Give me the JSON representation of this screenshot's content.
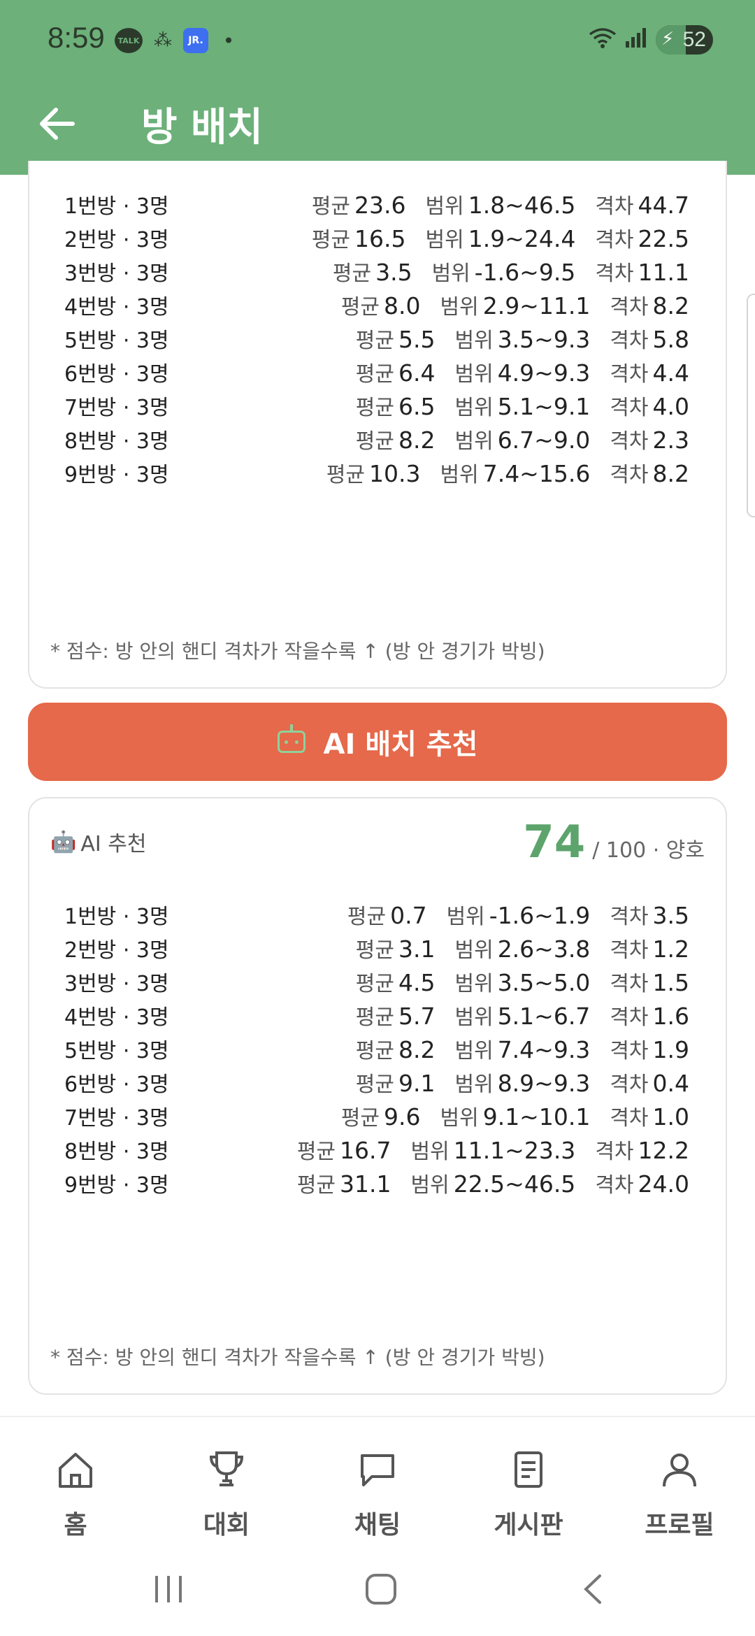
{
  "status": {
    "time": "8:59",
    "notif_talk": "TALK",
    "notif_jr": "JR.",
    "battery": "52"
  },
  "appbar": {
    "title": "방 배치"
  },
  "labels": {
    "avg": "평균",
    "range": "범위",
    "gap": "격차"
  },
  "current": {
    "rows": [
      {
        "name": "1번방 · 3명",
        "avg": "23.6",
        "range": "1.8~46.5",
        "gap": "44.7"
      },
      {
        "name": "2번방 · 3명",
        "avg": "16.5",
        "range": "1.9~24.4",
        "gap": "22.5"
      },
      {
        "name": "3번방 · 3명",
        "avg": "3.5",
        "range": "-1.6~9.5",
        "gap": "11.1"
      },
      {
        "name": "4번방 · 3명",
        "avg": "8.0",
        "range": "2.9~11.1",
        "gap": "8.2"
      },
      {
        "name": "5번방 · 3명",
        "avg": "5.5",
        "range": "3.5~9.3",
        "gap": "5.8"
      },
      {
        "name": "6번방 · 3명",
        "avg": "6.4",
        "range": "4.9~9.3",
        "gap": "4.4"
      },
      {
        "name": "7번방 · 3명",
        "avg": "6.5",
        "range": "5.1~9.1",
        "gap": "4.0"
      },
      {
        "name": "8번방 · 3명",
        "avg": "8.2",
        "range": "6.7~9.0",
        "gap": "2.3"
      },
      {
        "name": "9번방 · 3명",
        "avg": "10.3",
        "range": "7.4~15.6",
        "gap": "8.2"
      }
    ],
    "note": "* 점수: 방 안의 핸디 격차가 작을수록 ↑ (방 안 경기가 박빙)"
  },
  "ai_button": {
    "label": "AI 배치 추천"
  },
  "ai": {
    "header_label": "AI 추천",
    "score": "74",
    "score_suffix": "/ 100 · 양호",
    "rows": [
      {
        "name": "1번방 · 3명",
        "avg": "0.7",
        "range": "-1.6~1.9",
        "gap": "3.5"
      },
      {
        "name": "2번방 · 3명",
        "avg": "3.1",
        "range": "2.6~3.8",
        "gap": "1.2"
      },
      {
        "name": "3번방 · 3명",
        "avg": "4.5",
        "range": "3.5~5.0",
        "gap": "1.5"
      },
      {
        "name": "4번방 · 3명",
        "avg": "5.7",
        "range": "5.1~6.7",
        "gap": "1.6"
      },
      {
        "name": "5번방 · 3명",
        "avg": "8.2",
        "range": "7.4~9.3",
        "gap": "1.9"
      },
      {
        "name": "6번방 · 3명",
        "avg": "9.1",
        "range": "8.9~9.3",
        "gap": "0.4"
      },
      {
        "name": "7번방 · 3명",
        "avg": "9.6",
        "range": "9.1~10.1",
        "gap": "1.0"
      },
      {
        "name": "8번방 · 3명",
        "avg": "16.7",
        "range": "11.1~23.3",
        "gap": "12.2"
      },
      {
        "name": "9번방 · 3명",
        "avg": "31.1",
        "range": "22.5~46.5",
        "gap": "24.0"
      }
    ],
    "note": "* 점수: 방 안의 핸디 격차가 작을수록 ↑ (방 안 경기가 박빙)"
  },
  "nav": [
    {
      "label": "홈",
      "icon": "home-icon"
    },
    {
      "label": "대회",
      "icon": "trophy-icon"
    },
    {
      "label": "채팅",
      "icon": "chat-icon"
    },
    {
      "label": "게시판",
      "icon": "board-icon"
    },
    {
      "label": "프로필",
      "icon": "profile-icon"
    }
  ],
  "colors": {
    "header": "#6db07a",
    "ai_button": "#e5694a",
    "score": "#5da46c"
  }
}
